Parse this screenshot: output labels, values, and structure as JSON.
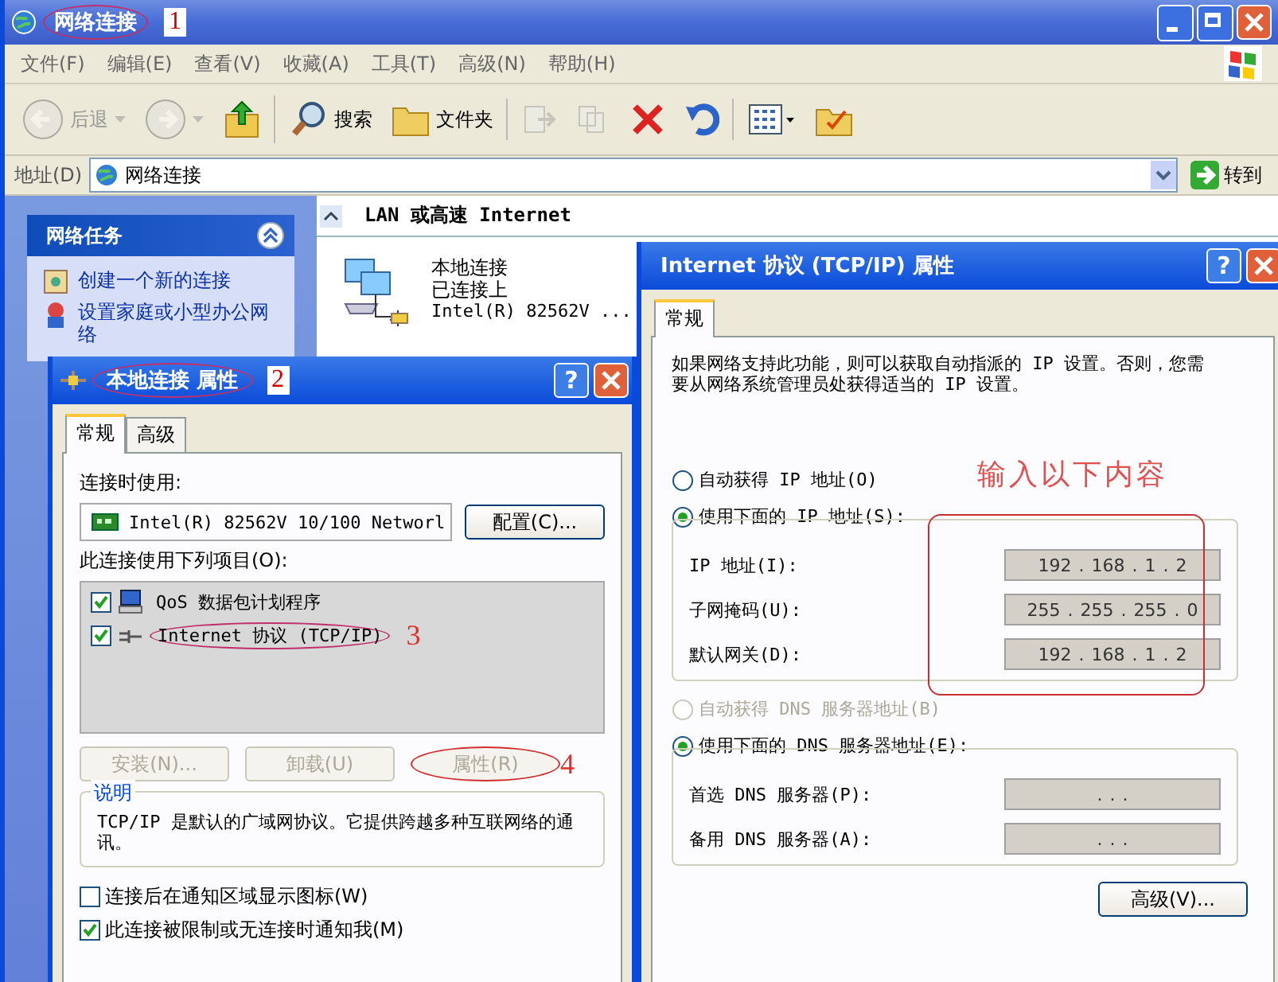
{
  "window": {
    "title": "网络连接",
    "annotation": "1"
  },
  "menu": [
    "文件(F)",
    "编辑(E)",
    "查看(V)",
    "收藏(A)",
    "工具(T)",
    "高级(N)",
    "帮助(H)"
  ],
  "toolbar": [
    {
      "kind": "back",
      "label": "后退",
      "disabled": true
    },
    {
      "kind": "forward",
      "disabled": true
    },
    {
      "kind": "up",
      "disabled": false
    },
    {
      "kind": "search",
      "label": "搜索",
      "disabled": false
    },
    {
      "kind": "folders",
      "label": "文件夹",
      "disabled": false
    },
    {
      "kind": "move",
      "disabled": true
    },
    {
      "kind": "copy",
      "disabled": true
    },
    {
      "kind": "delete",
      "disabled": false
    },
    {
      "kind": "undo",
      "disabled": false
    },
    {
      "kind": "views",
      "disabled": false
    },
    {
      "kind": "folder-options",
      "disabled": false
    }
  ],
  "address": {
    "label": "地址(D)",
    "value": "网络连接",
    "go": "转到"
  },
  "tasks": {
    "title": "网络任务",
    "expanded": true,
    "items": [
      "创建一个新的连接",
      "设置家庭或小型办公网络"
    ]
  },
  "content": {
    "group": "LAN 或高速 Internet",
    "items": [
      {
        "name": "本地连接",
        "status": "已连接上",
        "device": "Intel(R) 82562V ..."
      }
    ]
  },
  "local_dialog": {
    "title": "本地连接 属性",
    "annotation": "2",
    "help": "?",
    "tabs": [
      {
        "label": "常规",
        "selected": true
      },
      {
        "label": "高级",
        "selected": false
      }
    ],
    "connect_label": "连接时使用:",
    "adapter": "Intel(R) 82562V 10/100 Networl",
    "configure": "配置(C)...",
    "components_label": "此连接使用下列项目(O):",
    "components": [
      {
        "kind": "qos",
        "label": "QoS 数据包计划程序",
        "checked": true
      },
      {
        "kind": "protocol",
        "label": "Internet 协议 (TCP/IP)",
        "checked": true,
        "annotation": "3"
      }
    ],
    "buttons": [
      {
        "label": "安装(N)...",
        "disabled": true
      },
      {
        "label": "卸载(U)",
        "disabled": true
      },
      {
        "label": "属性(R)",
        "disabled": true,
        "annotation": "4"
      }
    ],
    "description_title": "说明",
    "description": "TCP/IP 是默认的广域网协议。它提供跨越多种互联网络的通讯。",
    "options": [
      {
        "label": "连接后在通知区域显示图标(W)",
        "checked": false
      },
      {
        "label": "此连接被限制或无连接时通知我(M)",
        "checked": true
      }
    ]
  },
  "tcpip_dialog": {
    "title": "Internet 协议 (TCP/IP) 属性",
    "help": "?",
    "tabs": [
      {
        "label": "常规",
        "selected": true
      }
    ],
    "intro": "如果网络支持此功能，则可以获取自动指派的 IP 设置。否则，您需要从网络系统管理员处获得适当的 IP 设置。",
    "ip_mode": [
      {
        "label": "自动获得 IP 地址(O)",
        "selected": false,
        "disabled": false
      },
      {
        "label": "使用下面的 IP 地址(S):",
        "selected": true,
        "disabled": false
      }
    ],
    "ip_fields": [
      {
        "label": "IP 地址(I):",
        "value": "192 . 168 . 1 . 2"
      },
      {
        "label": "子网掩码(U):",
        "value": "255 . 255 . 255 . 0"
      },
      {
        "label": "默认网关(D):",
        "value": "192 . 168 . 1 . 2"
      }
    ],
    "annotation": "输入以下内容",
    "dns_mode": [
      {
        "label": "自动获得 DNS 服务器地址(B)",
        "selected": false,
        "disabled": true
      },
      {
        "label": "使用下面的 DNS 服务器地址(E):",
        "selected": true,
        "disabled": false
      }
    ],
    "dns_fields": [
      {
        "label": "首选 DNS 服务器(P):",
        "value": ". . ."
      },
      {
        "label": "备用 DNS 服务器(A):",
        "value": ". . ."
      }
    ],
    "advanced": "高级(V)..."
  }
}
